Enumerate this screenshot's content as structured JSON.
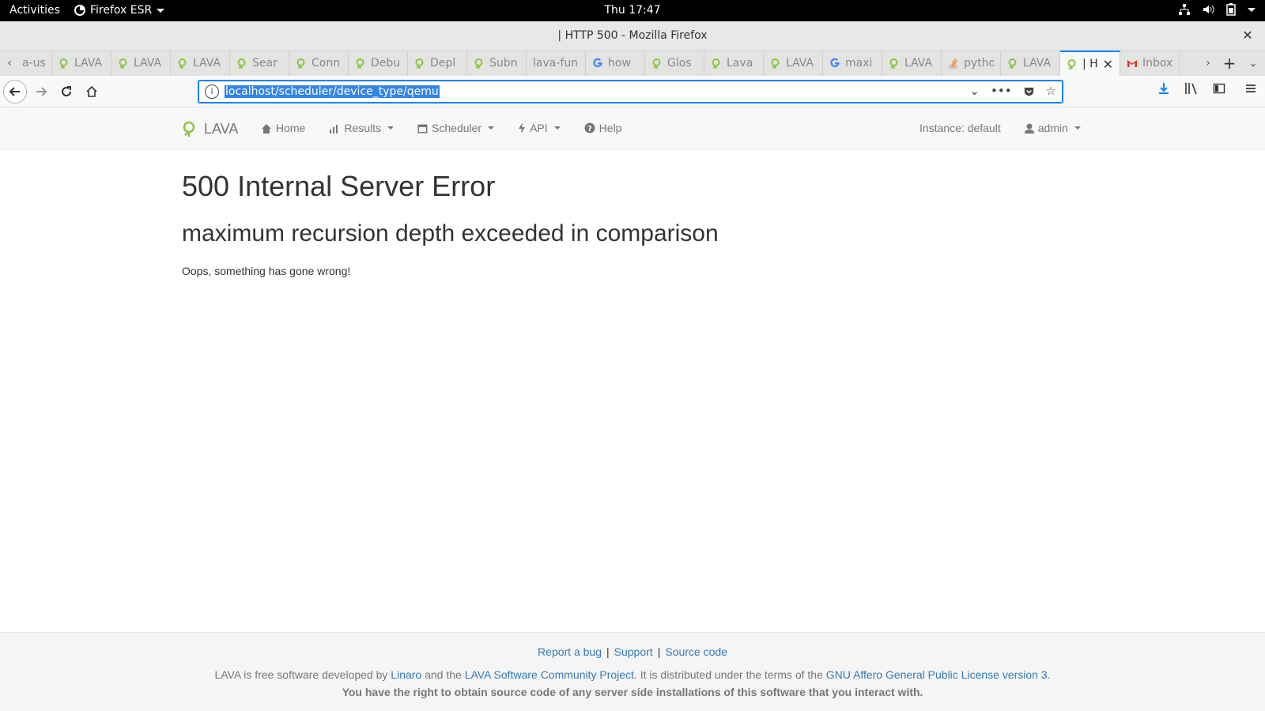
{
  "gnome": {
    "activities": "Activities",
    "app_menu": "Firefox ESR",
    "clock": "Thu 17:47"
  },
  "window": {
    "title": "| HTTP 500 - Mozilla Firefox",
    "close": "✕"
  },
  "tabs": [
    {
      "label": "a-us",
      "favicon": "lava-icon"
    },
    {
      "label": "LAVA",
      "favicon": "lava-icon"
    },
    {
      "label": "LAVA",
      "favicon": "lava-icon"
    },
    {
      "label": "LAVA",
      "favicon": "lava-icon"
    },
    {
      "label": "Sear",
      "favicon": "lava-icon"
    },
    {
      "label": "Conn",
      "favicon": "lava-icon"
    },
    {
      "label": "Debu",
      "favicon": "lava-icon"
    },
    {
      "label": "Depl",
      "favicon": "lava-icon"
    },
    {
      "label": "Subn",
      "favicon": "lava-icon"
    },
    {
      "label": "lava-fun",
      "favicon": "none"
    },
    {
      "label": "how",
      "favicon": "google-icon"
    },
    {
      "label": "Glos",
      "favicon": "lava-icon"
    },
    {
      "label": "Lava",
      "favicon": "lava-icon"
    },
    {
      "label": "LAVA",
      "favicon": "lava-icon"
    },
    {
      "label": "maxi",
      "favicon": "google-icon"
    },
    {
      "label": "LAVA",
      "favicon": "lava-icon"
    },
    {
      "label": "pytho",
      "favicon": "stackoverflow-icon"
    },
    {
      "label": "LAVA",
      "favicon": "lava-icon"
    },
    {
      "label": "| H",
      "favicon": "lava-icon",
      "active": true
    },
    {
      "label": "Inbox",
      "favicon": "gmail-icon"
    }
  ],
  "urlbar": {
    "url": "localhost/scheduler/device_type/qemu"
  },
  "lava_nav": {
    "brand": "LAVA",
    "home": "Home",
    "results": "Results",
    "scheduler": "Scheduler",
    "api": "API",
    "help": "Help",
    "instance": "Instance: default",
    "user": "admin"
  },
  "content": {
    "heading": "500 Internal Server Error",
    "subheading": "maximum recursion depth exceeded in comparison",
    "message": "Oops, something has gone wrong!"
  },
  "footer": {
    "report_bug": "Report a bug",
    "support": "Support",
    "source_code": "Source code",
    "lic_1": "LAVA is free software developed by ",
    "linaro": "Linaro",
    "lic_2": " and the ",
    "community": "LAVA Software Community Project",
    "lic_3": ". It is distributed under the terms of the ",
    "agpl": "GNU Affero General Public License version 3",
    "lic_4": ".",
    "rights": "You have the right to obtain source code of any server side installations of this software that you interact with."
  },
  "colors": {
    "accent": "#0a84ff",
    "link": "#337ab7",
    "lava_green": "#8dc63f"
  }
}
